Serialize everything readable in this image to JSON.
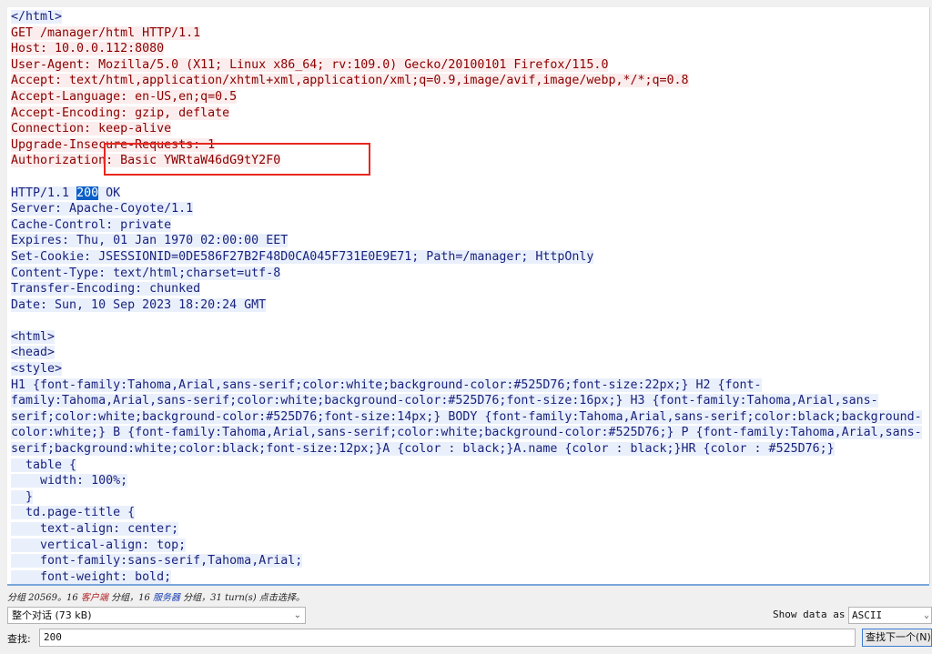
{
  "stream_lines": [
    {
      "text": "</html>",
      "side": "server"
    },
    {
      "text": "GET /manager/html HTTP/1.1",
      "side": "client"
    },
    {
      "text": "Host: 10.0.0.112:8080",
      "side": "client"
    },
    {
      "text": "User-Agent: Mozilla/5.0 (X11; Linux x86_64; rv:109.0) Gecko/20100101 Firefox/115.0",
      "side": "client"
    },
    {
      "text": "Accept: text/html,application/xhtml+xml,application/xml;q=0.9,image/avif,image/webp,*/*;q=0.8",
      "side": "client"
    },
    {
      "text": "Accept-Language: en-US,en;q=0.5",
      "side": "client"
    },
    {
      "text": "Accept-Encoding: gzip, deflate",
      "side": "client"
    },
    {
      "text": "Connection: keep-alive",
      "side": "client"
    },
    {
      "text": "Upgrade-Insecure-Requests: 1",
      "side": "client"
    },
    {
      "text": "Authorization: Basic YWRtaW46dG9tY2F0",
      "side": "client"
    },
    {
      "text": "",
      "side": "blank"
    },
    {
      "pre": "HTTP/1.1 ",
      "hit": "200",
      "post": " OK",
      "side": "server"
    },
    {
      "text": "Server: Apache-Coyote/1.1",
      "side": "server"
    },
    {
      "text": "Cache-Control: private",
      "side": "server"
    },
    {
      "text": "Expires: Thu, 01 Jan 1970 02:00:00 EET",
      "side": "server"
    },
    {
      "text": "Set-Cookie: JSESSIONID=0DE586F27B2F48D0CA045F731E0E9E71; Path=/manager; HttpOnly",
      "side": "server"
    },
    {
      "text": "Content-Type: text/html;charset=utf-8",
      "side": "server"
    },
    {
      "text": "Transfer-Encoding: chunked",
      "side": "server"
    },
    {
      "text": "Date: Sun, 10 Sep 2023 18:20:24 GMT",
      "side": "server"
    },
    {
      "text": "",
      "side": "blank"
    },
    {
      "text": "<html>",
      "side": "server"
    },
    {
      "text": "<head>",
      "side": "server"
    },
    {
      "text": "<style>",
      "side": "server"
    },
    {
      "text": "H1 {font-family:Tahoma,Arial,sans-serif;color:white;background-color:#525D76;font-size:22px;} H2 {font-",
      "side": "server"
    },
    {
      "text": "family:Tahoma,Arial,sans-serif;color:white;background-color:#525D76;font-size:16px;} H3 {font-family:Tahoma,Arial,sans-",
      "side": "server"
    },
    {
      "text": "serif;color:white;background-color:#525D76;font-size:14px;} BODY {font-family:Tahoma,Arial,sans-serif;color:black;background-",
      "side": "server"
    },
    {
      "text": "color:white;} B {font-family:Tahoma,Arial,sans-serif;color:white;background-color:#525D76;} P {font-family:Tahoma,Arial,sans-",
      "side": "server"
    },
    {
      "text": "serif;background:white;color:black;font-size:12px;}A {color : black;}A.name {color : black;}HR {color : #525D76;}",
      "side": "server"
    },
    {
      "text": "  table {",
      "side": "server"
    },
    {
      "text": "    width: 100%;",
      "side": "server"
    },
    {
      "text": "  }",
      "side": "server"
    },
    {
      "text": "  td.page-title {",
      "side": "server"
    },
    {
      "text": "    text-align: center;",
      "side": "server"
    },
    {
      "text": "    vertical-align: top;",
      "side": "server"
    },
    {
      "text": "    font-family:sans-serif,Tahoma,Arial;",
      "side": "server"
    },
    {
      "text": "    font-weight: bold;",
      "side": "server"
    }
  ],
  "status": {
    "part1": "分组 20569。16 ",
    "client_label": "客户端",
    "part2": " 分组，16 ",
    "server_label": "服务器",
    "part3": " 分组，31 turn(s) 点击选择。"
  },
  "conversation_select": {
    "value": "整个对话 (73 kB)"
  },
  "show_data": {
    "label": "Show data as",
    "value": "ASCII"
  },
  "find": {
    "label": "查找:",
    "value": "200",
    "button": "查找下一个(N)"
  },
  "colors": {
    "client_text": "#8b0000",
    "server_text": "#1a237e",
    "highlight": "#0a5fc8",
    "annotation_box": "#e8271f"
  }
}
